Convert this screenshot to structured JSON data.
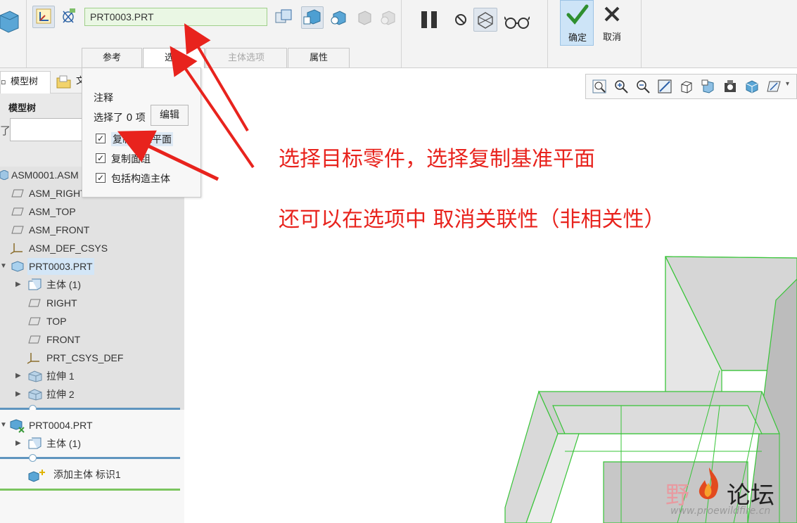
{
  "ribbon": {
    "selection_value": "PRT0003.PRT",
    "ok_label": "确定",
    "cancel_label": "取消",
    "tabs": [
      {
        "label": "参考",
        "state": "normal"
      },
      {
        "label": "选项",
        "state": "active"
      },
      {
        "label": "主体选项",
        "state": "disabled"
      },
      {
        "label": "属性",
        "state": "normal"
      }
    ]
  },
  "options_popup": {
    "section_title": "注释",
    "selected_count_text": "选择了 0 项",
    "edit_button": "编辑",
    "checkboxes": [
      {
        "label": "复制基准平面",
        "checked": true
      },
      {
        "label": "复制面组",
        "checked": true
      },
      {
        "label": "包括构造主体",
        "checked": true
      }
    ]
  },
  "left_panel": {
    "tab_model_tree": "模型树",
    "tab_second_partial": "文",
    "tree_title": "模型树",
    "filter_glyph": "了",
    "tree": [
      {
        "label": "ASM0001.ASM",
        "icon": "assembly-icon"
      },
      {
        "label": "ASM_RIGHT",
        "icon": "datum-plane-icon"
      },
      {
        "label": "ASM_TOP",
        "icon": "datum-plane-icon"
      },
      {
        "label": "ASM_FRONT",
        "icon": "datum-plane-icon"
      },
      {
        "label": "ASM_DEF_CSYS",
        "icon": "csys-icon"
      },
      {
        "label": "PRT0003.PRT",
        "icon": "part-icon"
      },
      {
        "label": "主体 (1)",
        "icon": "body-icon"
      },
      {
        "label": "RIGHT",
        "icon": "datum-plane-icon"
      },
      {
        "label": "TOP",
        "icon": "datum-plane-icon"
      },
      {
        "label": "FRONT",
        "icon": "datum-plane-icon"
      },
      {
        "label": "PRT_CSYS_DEF",
        "icon": "csys-icon"
      },
      {
        "label": "拉伸 1",
        "icon": "extrude-icon"
      },
      {
        "label": "拉伸 2",
        "icon": "extrude-icon"
      },
      {
        "label": "PRT0004.PRT",
        "icon": "part-new-icon"
      },
      {
        "label": "主体 (1)",
        "icon": "body-icon"
      },
      {
        "label": "添加主体 标识1",
        "icon": "add-body-icon"
      }
    ]
  },
  "annotations": {
    "line1": "选择目标零件，选择复制基准平面",
    "line2": "还可以在选项中 取消关联性（非相关性）"
  },
  "watermark": {
    "text_a": "野",
    "text_b": "论坛",
    "url": "www.proewildfire.cn"
  },
  "colors": {
    "annotation_red": "#e8231d",
    "model_edge_green": "#37c437",
    "highlight_blue": "#d3e6f7"
  }
}
